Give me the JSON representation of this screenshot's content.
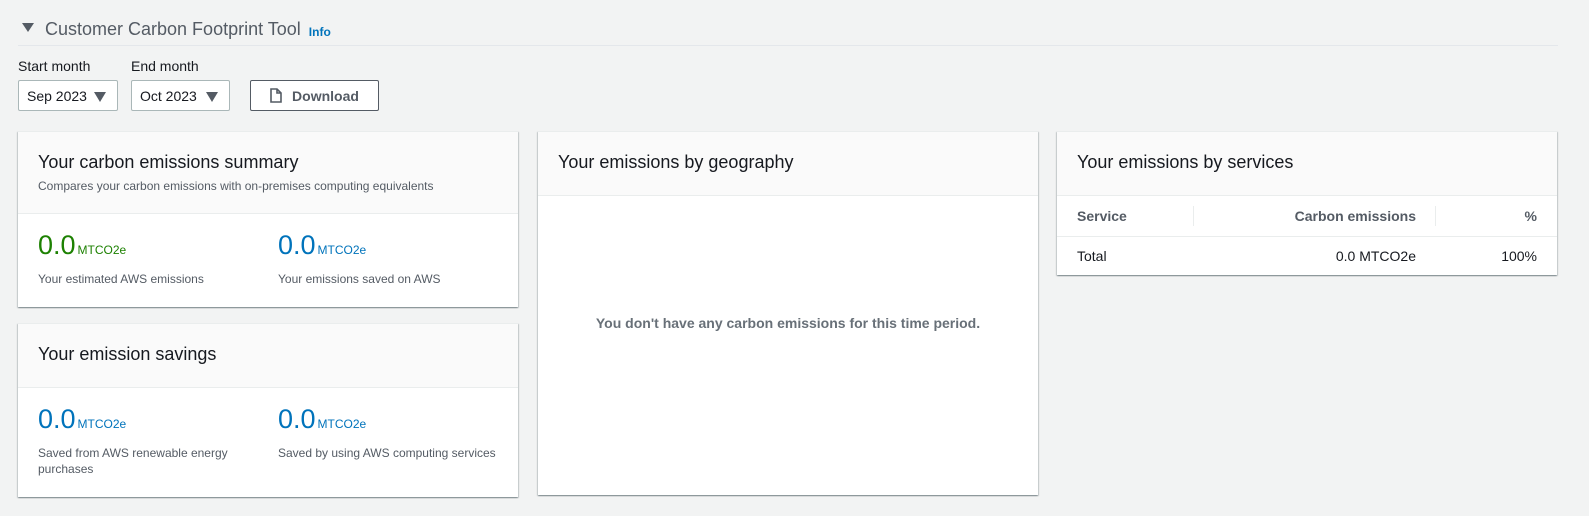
{
  "header": {
    "title": "Customer Carbon Footprint Tool",
    "info": "Info"
  },
  "controls": {
    "start_label": "Start month",
    "start_value": "Sep 2023",
    "end_label": "End month",
    "end_value": "Oct 2023",
    "download_label": "Download"
  },
  "summary": {
    "title": "Your carbon emissions summary",
    "subtitle": "Compares your carbon emissions with on-premises computing equivalents",
    "metrics": [
      {
        "value": "0.0",
        "unit": "MTCO2e",
        "desc": "Your estimated AWS emissions"
      },
      {
        "value": "0.0",
        "unit": "MTCO2e",
        "desc": "Your emissions saved on AWS"
      }
    ]
  },
  "savings": {
    "title": "Your emission savings",
    "metrics": [
      {
        "value": "0.0",
        "unit": "MTCO2e",
        "desc": "Saved from AWS renewable energy purchases"
      },
      {
        "value": "0.0",
        "unit": "MTCO2e",
        "desc": "Saved by using AWS computing services"
      }
    ]
  },
  "geography": {
    "title": "Your emissions by geography",
    "empty_message": "You don't have any carbon emissions for this time period."
  },
  "services": {
    "title": "Your emissions by services",
    "columns": [
      "Service",
      "Carbon emissions",
      "%"
    ],
    "rows": [
      {
        "service": "Total",
        "emissions": "0.0 MTCO2e",
        "percent": "100%"
      }
    ]
  },
  "colors": {
    "accent_green": "#1d8102",
    "accent_blue": "#0073bb"
  }
}
